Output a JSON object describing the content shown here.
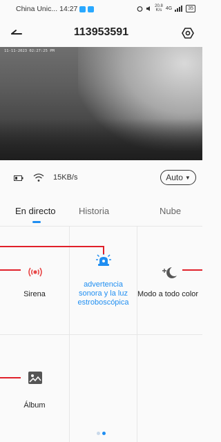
{
  "status_bar": {
    "carrier": "China Unic...",
    "time": "14:27",
    "net_speed_value": "20.8",
    "net_speed_unit": "K/s",
    "signal": "4G",
    "battery": "35"
  },
  "header": {
    "title": "113953591",
    "back_icon": "back-arrow-icon",
    "settings_icon": "settings-hexagon-icon"
  },
  "video": {
    "timestamp": "11-11-2023 02:27:25 PM"
  },
  "info_bar": {
    "speed": "15KB/s",
    "quality": "Auto"
  },
  "tabs": [
    {
      "label": "En directo",
      "active": true
    },
    {
      "label": "Historia",
      "active": false
    },
    {
      "label": "Nube",
      "active": false
    }
  ],
  "features": {
    "siren": "Sirena",
    "strobe": "advertencia sonora y la luz estroboscópica",
    "color_mode": "Modo a todo color",
    "album": "Álbum"
  },
  "colors": {
    "accent": "#1f8ef1",
    "siren_red": "#e84a4a",
    "annotation_red": "#e0202a"
  },
  "pager": {
    "pages": 2,
    "current": 2
  }
}
